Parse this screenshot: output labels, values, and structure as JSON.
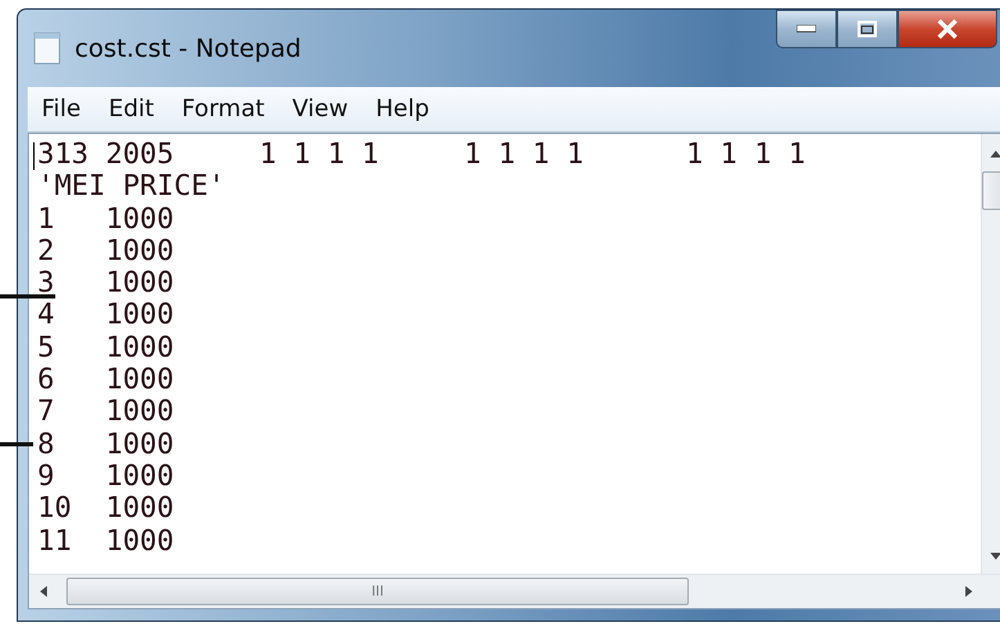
{
  "window": {
    "title": "cost.cst - Notepad"
  },
  "menu": [
    "File",
    "Edit",
    "Format",
    "View",
    "Help"
  ],
  "editor": {
    "lines": [
      "313 2005     1 1 1 1     1 1 1 1      1 1 1 1",
      "'MEI PRICE'",
      "1   1000",
      "2   1000",
      "3   1000",
      "4   1000",
      "5   1000",
      "6   1000",
      "7   1000",
      "8   1000",
      "9   1000",
      "10  1000",
      "11  1000"
    ]
  },
  "horizontal_scrollbar": {
    "thumb_label": "III"
  }
}
